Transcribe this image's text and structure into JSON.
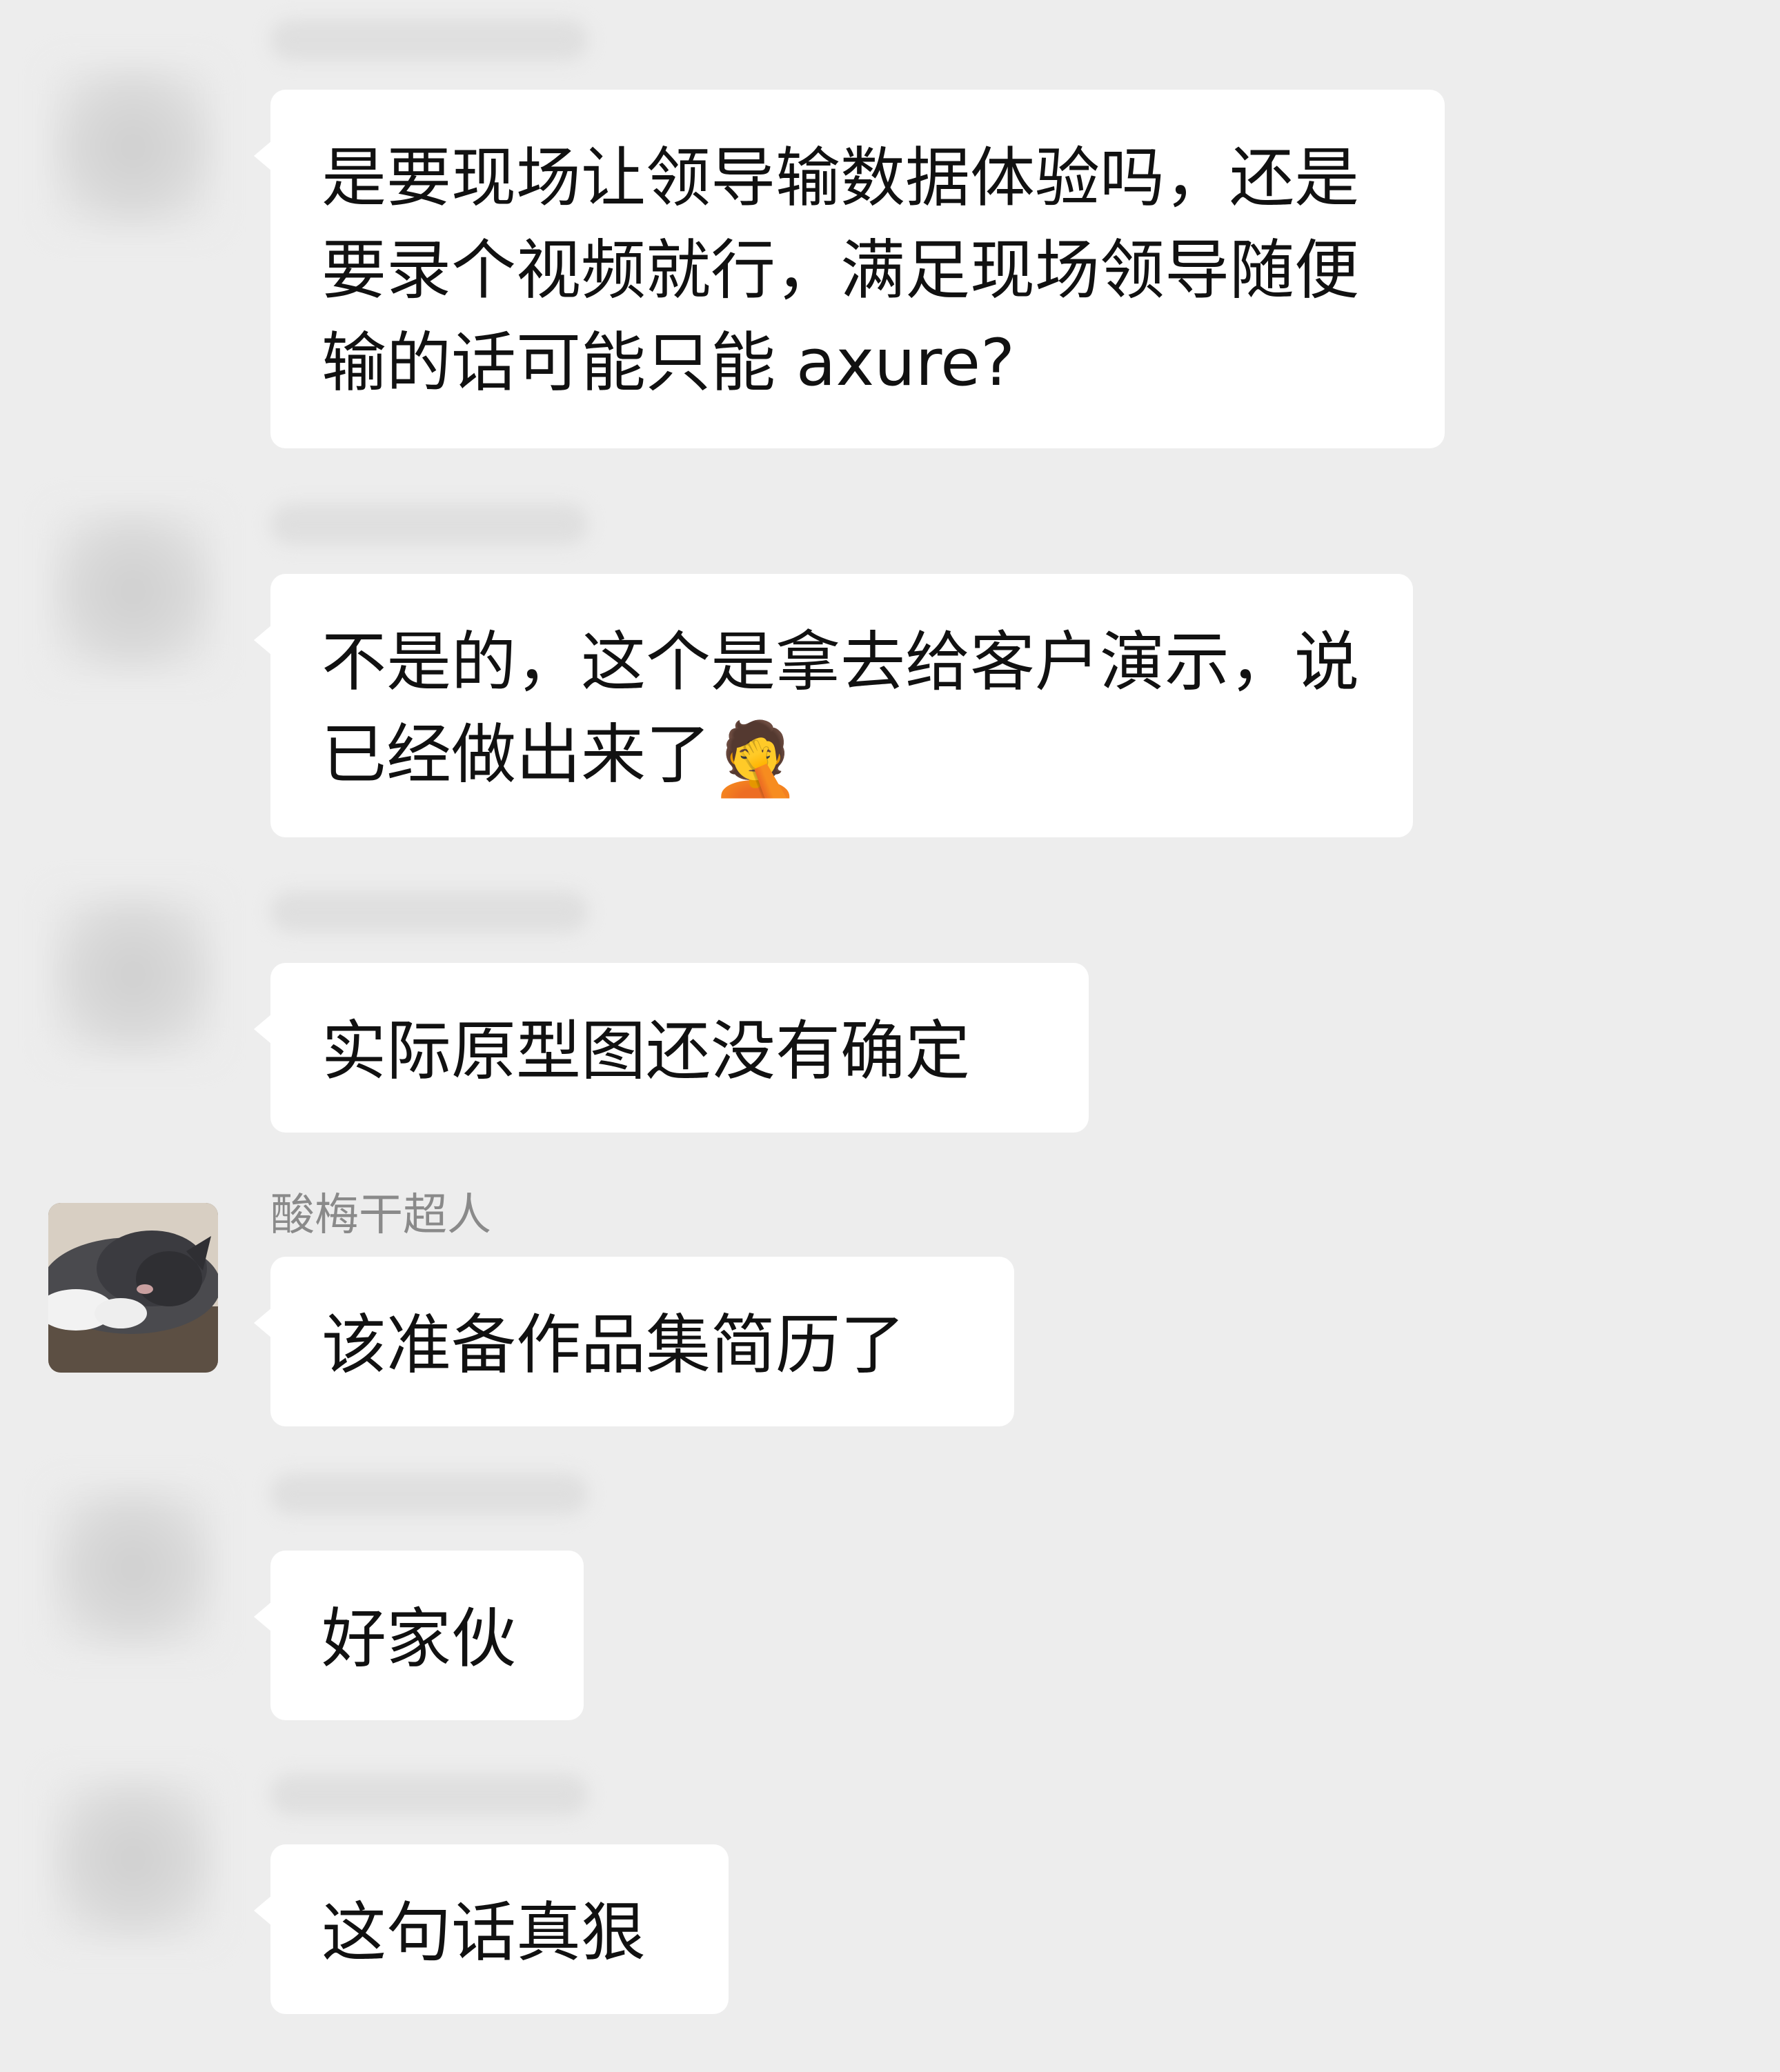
{
  "messages": [
    {
      "sender": "",
      "text": "是要现场让领导输数据体验吗，还是要录个视频就行，满足现场领导随便输的话可能只能 axure?"
    },
    {
      "sender": "",
      "text": "不是的，这个是拿去给客户演示，说已经做出来了",
      "emoji": "🤦"
    },
    {
      "sender": "",
      "text": "实际原型图还没有确定"
    },
    {
      "sender": "酸梅干超人",
      "text": "该准备作品集简历了"
    },
    {
      "sender": "",
      "text": "好家伙"
    },
    {
      "sender": "",
      "text": "这句话真狠"
    }
  ]
}
